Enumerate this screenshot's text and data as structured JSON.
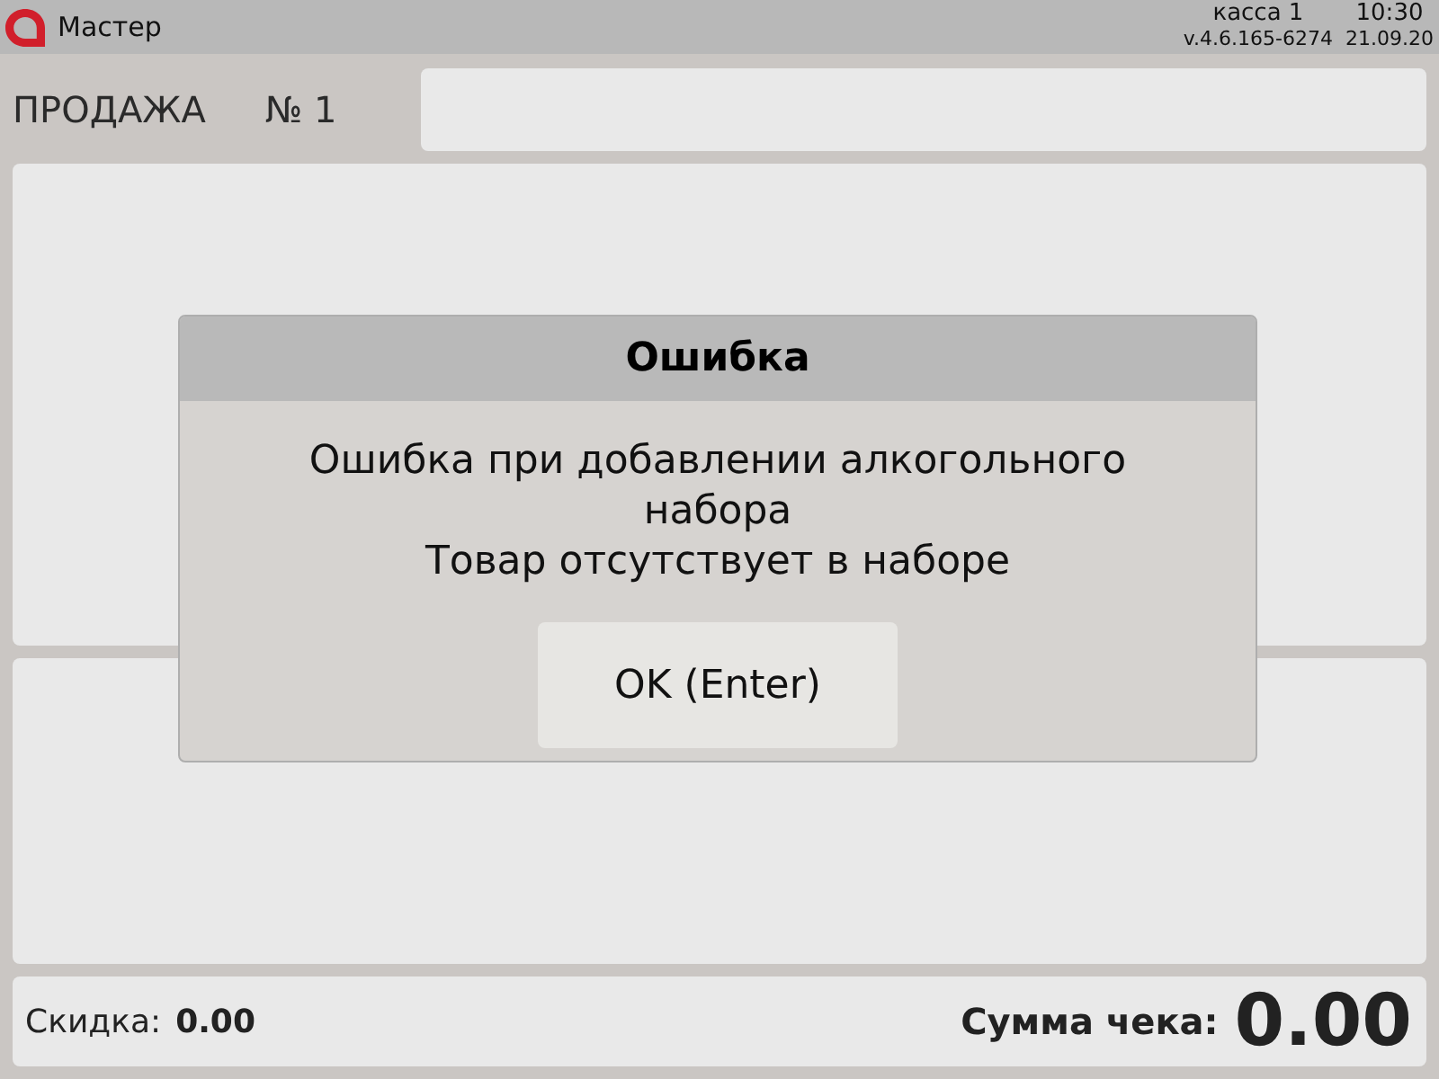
{
  "top_bar": {
    "app_name": "Мастер",
    "register": "касса 1",
    "time": "10:30",
    "version": "v.4.6.165-6274",
    "date": "21.09.20"
  },
  "sale": {
    "title": "ПРОДАЖА",
    "number": "№ 1"
  },
  "footer": {
    "discount_label": "Скидка:",
    "discount_value": "0.00",
    "total_label": "Сумма чека:",
    "total_value": "0.00"
  },
  "dialog": {
    "title": "Ошибка",
    "message": [
      "Ошибка при добавлении алкогольного набора",
      "Товар отсутствует в наборе"
    ],
    "button": "OK (Enter)"
  }
}
